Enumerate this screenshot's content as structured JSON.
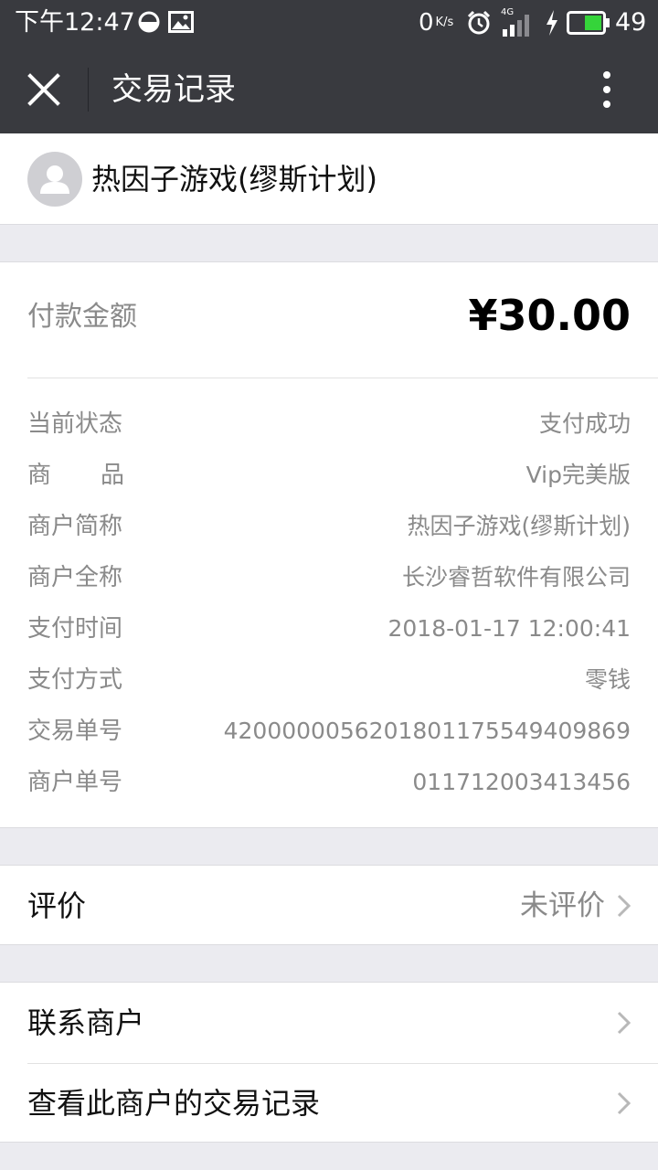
{
  "status_bar": {
    "time": "下午12:47",
    "net_speed": "0",
    "net_unit": "K/s",
    "signal_type": "4G",
    "battery_level": "49",
    "icons": [
      "half-circle-icon",
      "image-icon",
      "alarm-icon",
      "signal-icon",
      "charging-icon",
      "battery-icon"
    ]
  },
  "title_bar": {
    "title": "交易记录",
    "close_icon": "close-icon",
    "more_icon": "more-vertical-icon"
  },
  "merchant": {
    "name": "热因子游戏(缪斯计划)",
    "avatar_icon": "avatar-placeholder-icon"
  },
  "payment": {
    "amount_label": "付款金额",
    "amount": "¥30.00"
  },
  "details": [
    {
      "label": "当前状态",
      "value": "支付成功"
    },
    {
      "label": "商品",
      "value": "Vip完美版"
    },
    {
      "label": "商户简称",
      "value": "热因子游戏(缪斯计划)"
    },
    {
      "label": "商户全称",
      "value": "长沙睿哲软件有限公司"
    },
    {
      "label": "支付时间",
      "value": "2018-01-17 12:00:41"
    },
    {
      "label": "支付方式",
      "value": "零钱"
    },
    {
      "label": "交易单号",
      "value": "4200000056201801175549409869"
    },
    {
      "label": "商户单号",
      "value": "011712003413456"
    }
  ],
  "review": {
    "label": "评价",
    "value": "未评价"
  },
  "actions": [
    {
      "label": "联系商户"
    },
    {
      "label": "查看此商户的交易记录"
    }
  ],
  "colors": {
    "bar_bg": "#393a3f",
    "page_bg": "#ebebf0",
    "muted_text": "#8a8a8a",
    "battery_fill": "#35d43a"
  }
}
